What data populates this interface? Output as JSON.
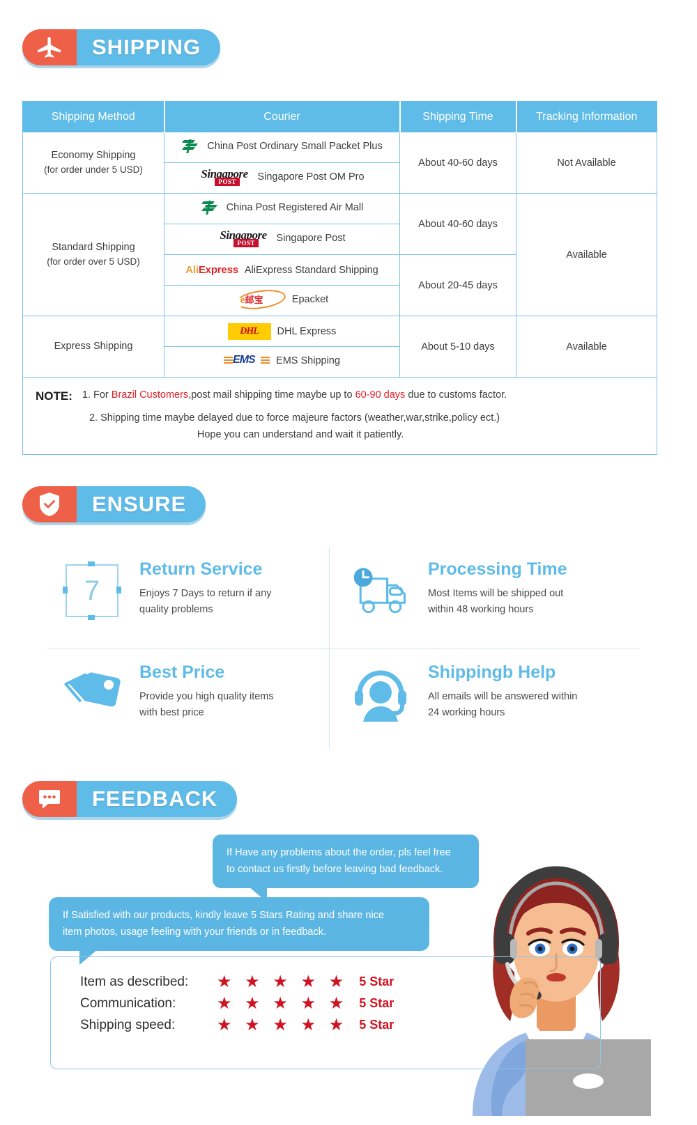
{
  "sections": {
    "shipping": {
      "label": "SHIPPING",
      "icon": "airplane-icon"
    },
    "ensure": {
      "label": "ENSURE",
      "icon": "shield-check-icon"
    },
    "feedback": {
      "label": "FEEDBACK",
      "icon": "chat-bubble-icon"
    }
  },
  "colors": {
    "brand_blue": "#5fbbe8",
    "accent_orange": "#ef6048",
    "star_red": "#cf1322",
    "note_red": "#e01b24",
    "table_border": "#7cc3e0"
  },
  "shipping_table": {
    "headers": [
      "Shipping Method",
      "Courier",
      "Shipping Time",
      "Tracking Information"
    ],
    "methods": [
      {
        "name": "Economy Shipping",
        "sub": "(for order under 5 USD)"
      },
      {
        "name": "Standard Shipping",
        "sub": "(for order over 5 USD)"
      },
      {
        "name": "Express Shipping",
        "sub": ""
      }
    ],
    "couriers": [
      {
        "logo": "china-post-logo",
        "label": "China Post Ordinary Small Packet Plus"
      },
      {
        "logo": "singapore-post-logo",
        "label": "Singapore Post OM Pro"
      },
      {
        "logo": "china-post-logo",
        "label": "China Post Registered Air Mall"
      },
      {
        "logo": "singapore-post-logo",
        "label": "Singapore Post"
      },
      {
        "logo": "aliexpress-logo",
        "label": "AliExpress Standard Shipping"
      },
      {
        "logo": "epacket-logo",
        "label": "Epacket"
      },
      {
        "logo": "dhl-logo",
        "label": "DHL Express"
      },
      {
        "logo": "ems-logo",
        "label": "EMS Shipping"
      }
    ],
    "times": [
      "About 40-60 days",
      "About 40-60 days",
      "About 20-45 days",
      "About 5-10 days"
    ],
    "tracking": [
      "Not Available",
      "Available",
      "Available"
    ],
    "note": {
      "title": "NOTE:",
      "line1_a": "1. For ",
      "line1_red1": "Brazil Customers",
      "line1_b": ",post mail shipping time maybe up to ",
      "line1_red2": "60-90 days",
      "line1_c": " due to customs factor.",
      "line2": "2. Shipping time maybe delayed due to force majeure factors (weather,war,strike,policy ect.)",
      "line3": "Hope you can understand and wait it patiently."
    }
  },
  "ensure_items": [
    {
      "icon": "calendar-7-days-icon",
      "title": "Return Service",
      "desc_line1": "Enjoys 7 Days to return if any",
      "desc_line2": "quality problems",
      "number": "7"
    },
    {
      "icon": "truck-clock-icon",
      "title": "Processing Time",
      "desc_line1": "Most Items will be shipped out",
      "desc_line2": "within 48 working hours"
    },
    {
      "icon": "price-tag-icon",
      "title": "Best Price",
      "desc_line1": "Provide you high quality items",
      "desc_line2": "with best price"
    },
    {
      "icon": "headset-support-icon",
      "title": "Shippingb Help",
      "desc_line1": "All emails will be answered within",
      "desc_line2": "24 working hours"
    }
  ],
  "feedback": {
    "bubble1_line1": "If Have any problems about the order, pls feel free",
    "bubble1_line2": "to contact us firstly before leaving bad feedback.",
    "bubble2_line1": "If Satisfied with our products, kindly leave 5 Stars Rating and share nice",
    "bubble2_line2": "item photos, usage feeling with your friends or in feedback.",
    "ratings": [
      {
        "label": "Item as described:",
        "stars": "★ ★ ★ ★ ★",
        "value": "5 Star"
      },
      {
        "label": "Communication:",
        "stars": "★ ★ ★ ★ ★",
        "value": "5 Star"
      },
      {
        "label": "Shipping speed:",
        "stars": "★ ★ ★ ★ ★",
        "value": "5 Star"
      }
    ],
    "agent_icon": "customer-service-agent-illustration"
  }
}
